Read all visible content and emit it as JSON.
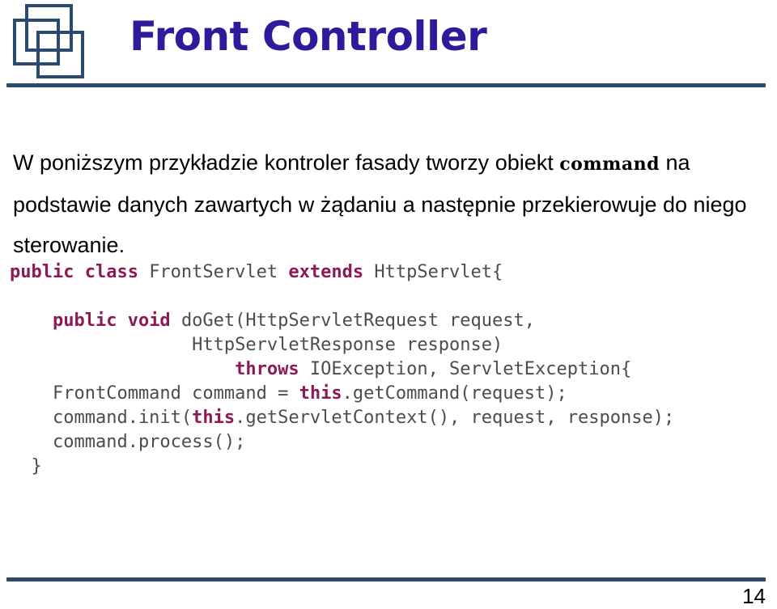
{
  "header": {
    "logo_icon": "three-overlapping-squares-logo",
    "title": "Front Controller",
    "title_color": "#2E1A9B",
    "rule_color": "#2B4A6F"
  },
  "body": {
    "paragraph": {
      "part1": "W poniższym przykładzie kontroler fasady tworzy obiekt ",
      "inline_code": "command",
      "part2": " na podstawie danych zawartych w żądaniu a następnie przekierowuje do niego sterowanie."
    }
  },
  "code": {
    "keyword_color": "#8C1A56",
    "text_color": "#4C4C4C",
    "lines": [
      {
        "id": "line-class-decl",
        "tokens": [
          {
            "t": "public class ",
            "kw": true
          },
          {
            "t": "FrontServlet ",
            "kw": false
          },
          {
            "t": "extends ",
            "kw": true
          },
          {
            "t": "HttpServlet{",
            "kw": false
          }
        ]
      },
      {
        "id": "line-blank-1",
        "tokens": [
          {
            "t": " ",
            "kw": false
          }
        ]
      },
      {
        "id": "line-doget-signature",
        "tokens": [
          {
            "t": "    ",
            "kw": false
          },
          {
            "t": "public void ",
            "kw": true
          },
          {
            "t": "doGet(HttpServletRequest request,",
            "kw": false
          }
        ]
      },
      {
        "id": "line-response-param",
        "tokens": [
          {
            "t": "                 HttpServletResponse response)",
            "kw": false
          }
        ]
      },
      {
        "id": "line-throws",
        "tokens": [
          {
            "t": "                     ",
            "kw": false
          },
          {
            "t": "throws ",
            "kw": true
          },
          {
            "t": "IOException, ServletException{",
            "kw": false
          }
        ]
      },
      {
        "id": "line-get-command",
        "tokens": [
          {
            "t": "    FrontCommand command = ",
            "kw": false
          },
          {
            "t": "this",
            "kw": true
          },
          {
            "t": ".getCommand(request);",
            "kw": false
          }
        ]
      },
      {
        "id": "line-command-init",
        "tokens": [
          {
            "t": "    command.init(",
            "kw": false
          },
          {
            "t": "this",
            "kw": true
          },
          {
            "t": ".getServletContext(), request, response);",
            "kw": false
          }
        ]
      },
      {
        "id": "line-command-process",
        "tokens": [
          {
            "t": "    command.process();",
            "kw": false
          }
        ]
      },
      {
        "id": "line-close-brace",
        "tokens": [
          {
            "t": "  }",
            "kw": false
          }
        ]
      }
    ]
  },
  "footer": {
    "page_number": "14",
    "rule_color": "#2B4A6F"
  }
}
